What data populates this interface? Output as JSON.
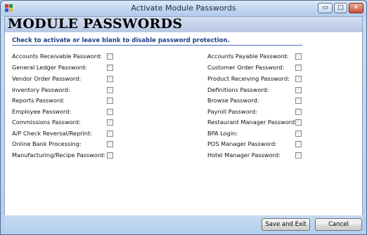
{
  "window": {
    "title": "Activate Module Passwords",
    "controls": {
      "minimize": "▭",
      "maximize": "□",
      "close": "✕"
    }
  },
  "header": {
    "title": "MODULE PASSWORDS"
  },
  "instructions": "Check to activate or leave blank to disable password protection.",
  "left_column": [
    {
      "label": "Accounts Receivable Password:",
      "checked": false
    },
    {
      "label": "General Ledger Password:",
      "checked": false
    },
    {
      "label": "Vendor Order Password:",
      "checked": false
    },
    {
      "label": "Inventory Password:",
      "checked": false
    },
    {
      "label": "Reports Password:",
      "checked": false
    },
    {
      "label": "Employee Password:",
      "checked": false
    },
    {
      "label": "Commissions Password:",
      "checked": false
    },
    {
      "label": "A/P Check Reversal/Reprint:",
      "checked": false
    },
    {
      "label": "Online Bank Processing:",
      "checked": false
    },
    {
      "label": "Manufacturing/Recipe Password:",
      "checked": false
    }
  ],
  "right_column": [
    {
      "label": "Accounts Payable Password:",
      "checked": false
    },
    {
      "label": "Customer Order Password:",
      "checked": false
    },
    {
      "label": "Product Receiving Password:",
      "checked": false
    },
    {
      "label": "Definitions Password:",
      "checked": false
    },
    {
      "label": "Browse Password:",
      "checked": false
    },
    {
      "label": "Payroll Password:",
      "checked": false
    },
    {
      "label": "Restaurant Manager Password:",
      "checked": false
    },
    {
      "label": "BPA Login:",
      "checked": false
    },
    {
      "label": "POS Manager Password:",
      "checked": false
    },
    {
      "label": "Hotel Manager Password:",
      "checked": false
    }
  ],
  "buttons": {
    "save": "Save and Exit",
    "cancel": "Cancel"
  },
  "colors": {
    "instructions_text": "#1d3f8a",
    "divider": "#4870b5",
    "header_band": "#c3d0ea"
  }
}
